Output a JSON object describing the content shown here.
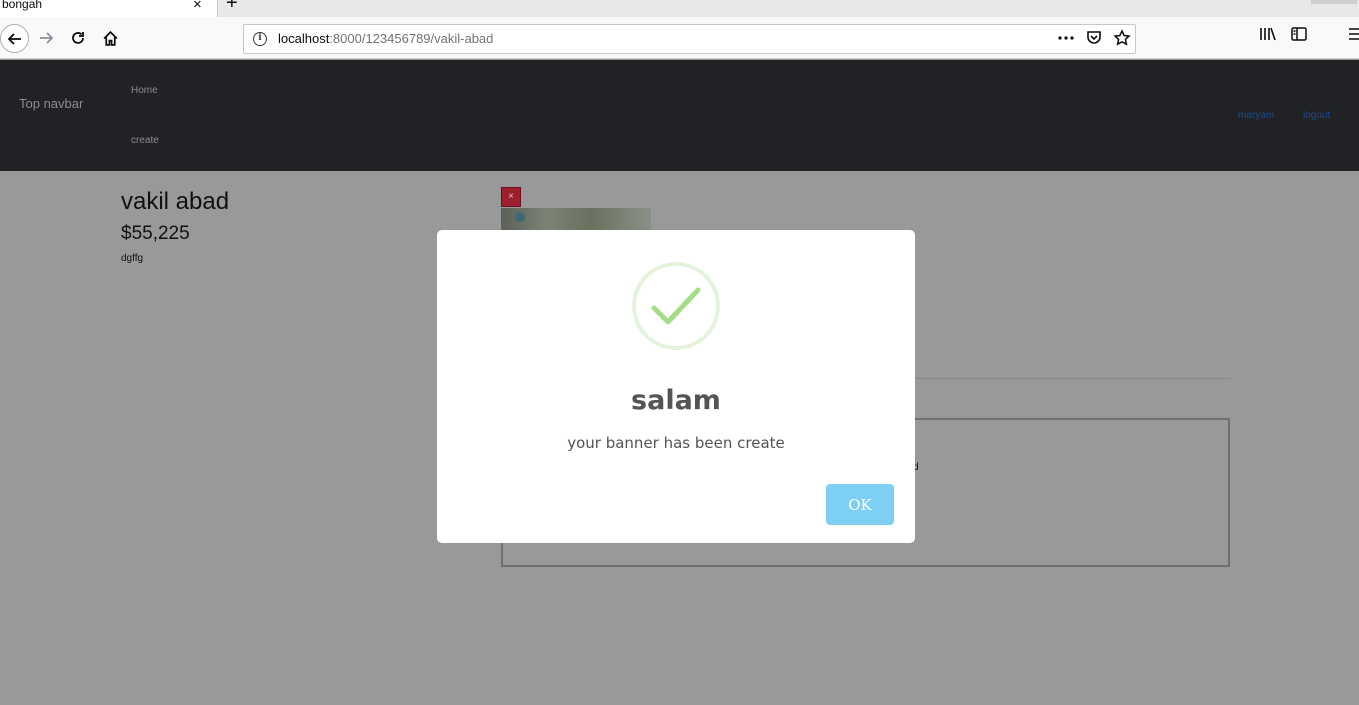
{
  "browser": {
    "tab_title": "bongah",
    "tab_close": "×",
    "new_tab": "+",
    "url_host": "localhost",
    "url_path": ":8000/123456789/vakil-abad",
    "icons": [
      "back-icon",
      "forward-icon",
      "reload-icon",
      "home-icon",
      "info-icon",
      "more-icon",
      "pocket-icon",
      "star-icon",
      "library-icon",
      "sidebar-icon",
      "menu-icon"
    ]
  },
  "site_nav": {
    "brand": "Top navbar",
    "links": [
      "Home",
      "create"
    ],
    "user": "maryam",
    "logout": "logout"
  },
  "page": {
    "title": "vakil abad",
    "price": "$55,225",
    "description": "dgffg",
    "remove_label": "×",
    "box_text_fragment": "d"
  },
  "modal": {
    "title": "salam",
    "text": "your banner has been create",
    "ok_label": "OK",
    "accent_color": "#a5dc86",
    "button_color": "#7ecff4"
  }
}
